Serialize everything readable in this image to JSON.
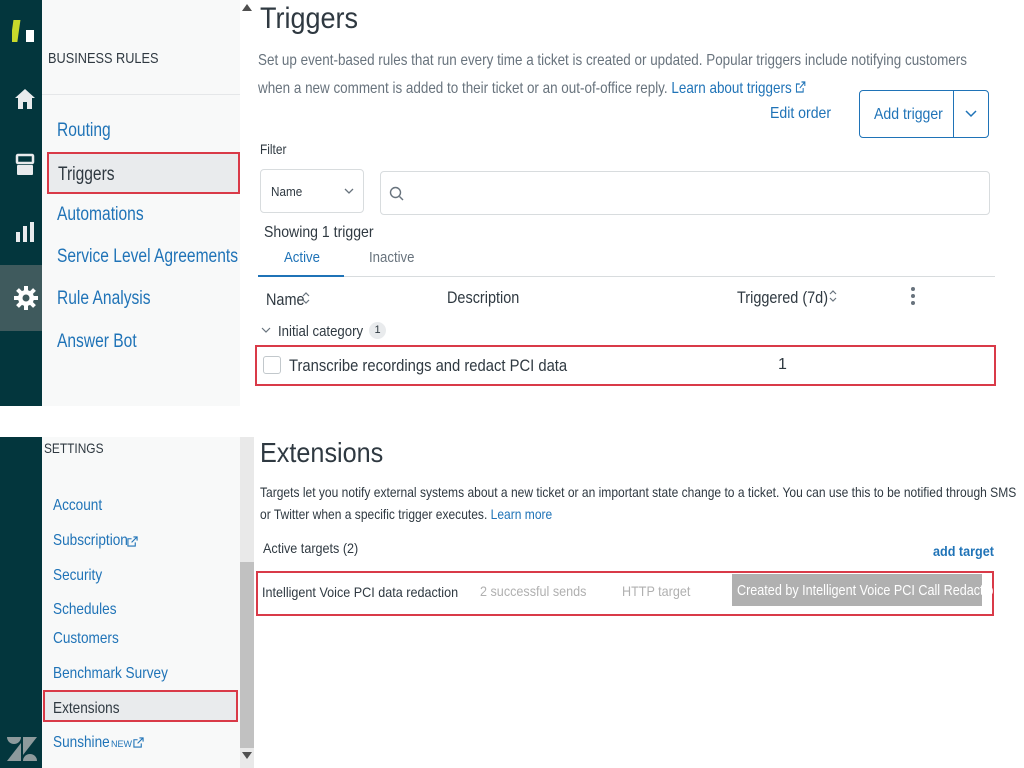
{
  "top_sidebar": {
    "heading": "BUSINESS RULES",
    "items": [
      {
        "label": "Routing",
        "selected": false
      },
      {
        "label": "Triggers",
        "selected": true
      },
      {
        "label": "Automations",
        "selected": false
      },
      {
        "label": "Service Level Agreements",
        "selected": false
      },
      {
        "label": "Rule Analysis",
        "selected": false
      },
      {
        "label": "Answer Bot",
        "selected": false
      }
    ]
  },
  "rail": {
    "icons": [
      "zendesk-logo-icon",
      "home-icon",
      "views-icon",
      "reporting-icon",
      "settings-gear-icon"
    ],
    "active": "settings-gear-icon"
  },
  "triggers": {
    "title": "Triggers",
    "description": "Set up event-based rules that run every time a ticket is created or updated. Popular triggers include notifying customers when a new comment is added to their ticket or an out-of-office reply.",
    "learn_link": "Learn about triggers",
    "edit_order": "Edit order",
    "add_trigger": "Add trigger",
    "filter_label": "Filter",
    "filter_select": "Name",
    "search_placeholder": "",
    "showing": "Showing 1 trigger",
    "tabs": [
      {
        "label": "Active",
        "selected": true
      },
      {
        "label": "Inactive",
        "selected": false
      }
    ],
    "columns": {
      "name": "Name",
      "description": "Description",
      "triggered": "Triggered (7d)"
    },
    "category": {
      "label": "Initial category",
      "count": "1"
    },
    "rows": [
      {
        "name": "Transcribe recordings and redact PCI data",
        "description": "",
        "triggered": "1"
      }
    ]
  },
  "bottom_sidebar": {
    "heading": "SETTINGS",
    "items": [
      {
        "label": "Account",
        "external": false,
        "selected": false
      },
      {
        "label": "Subscription",
        "external": true,
        "selected": false
      },
      {
        "label": "Security",
        "external": false,
        "selected": false
      },
      {
        "label": "Schedules",
        "external": false,
        "selected": false
      },
      {
        "label": "Customers",
        "external": false,
        "selected": false
      },
      {
        "label": "Benchmark Survey",
        "external": false,
        "selected": false
      },
      {
        "label": "Extensions",
        "external": false,
        "selected": true
      },
      {
        "label": "Sunshine",
        "tag": "NEW",
        "external": true,
        "selected": false
      }
    ]
  },
  "extensions": {
    "title": "Extensions",
    "description": "Targets let you notify external systems about a new ticket or an important state change to a ticket. You can use this to be notified through SMS or Twitter when a specific trigger executes.",
    "learn_more": "Learn more",
    "active_targets": "Active targets (2)",
    "add_target": "add target",
    "rows": [
      {
        "name": "Intelligent Voice PCI data redaction",
        "sends": "2 successful sends",
        "type": "HTTP target",
        "created_by": "Created by Intelligent Voice PCI Call Redaction"
      }
    ]
  },
  "colors": {
    "rail": "#03363d",
    "link": "#1f73b7",
    "highlight_border": "#d93a48",
    "badge_gray": "#b0b0b0"
  }
}
